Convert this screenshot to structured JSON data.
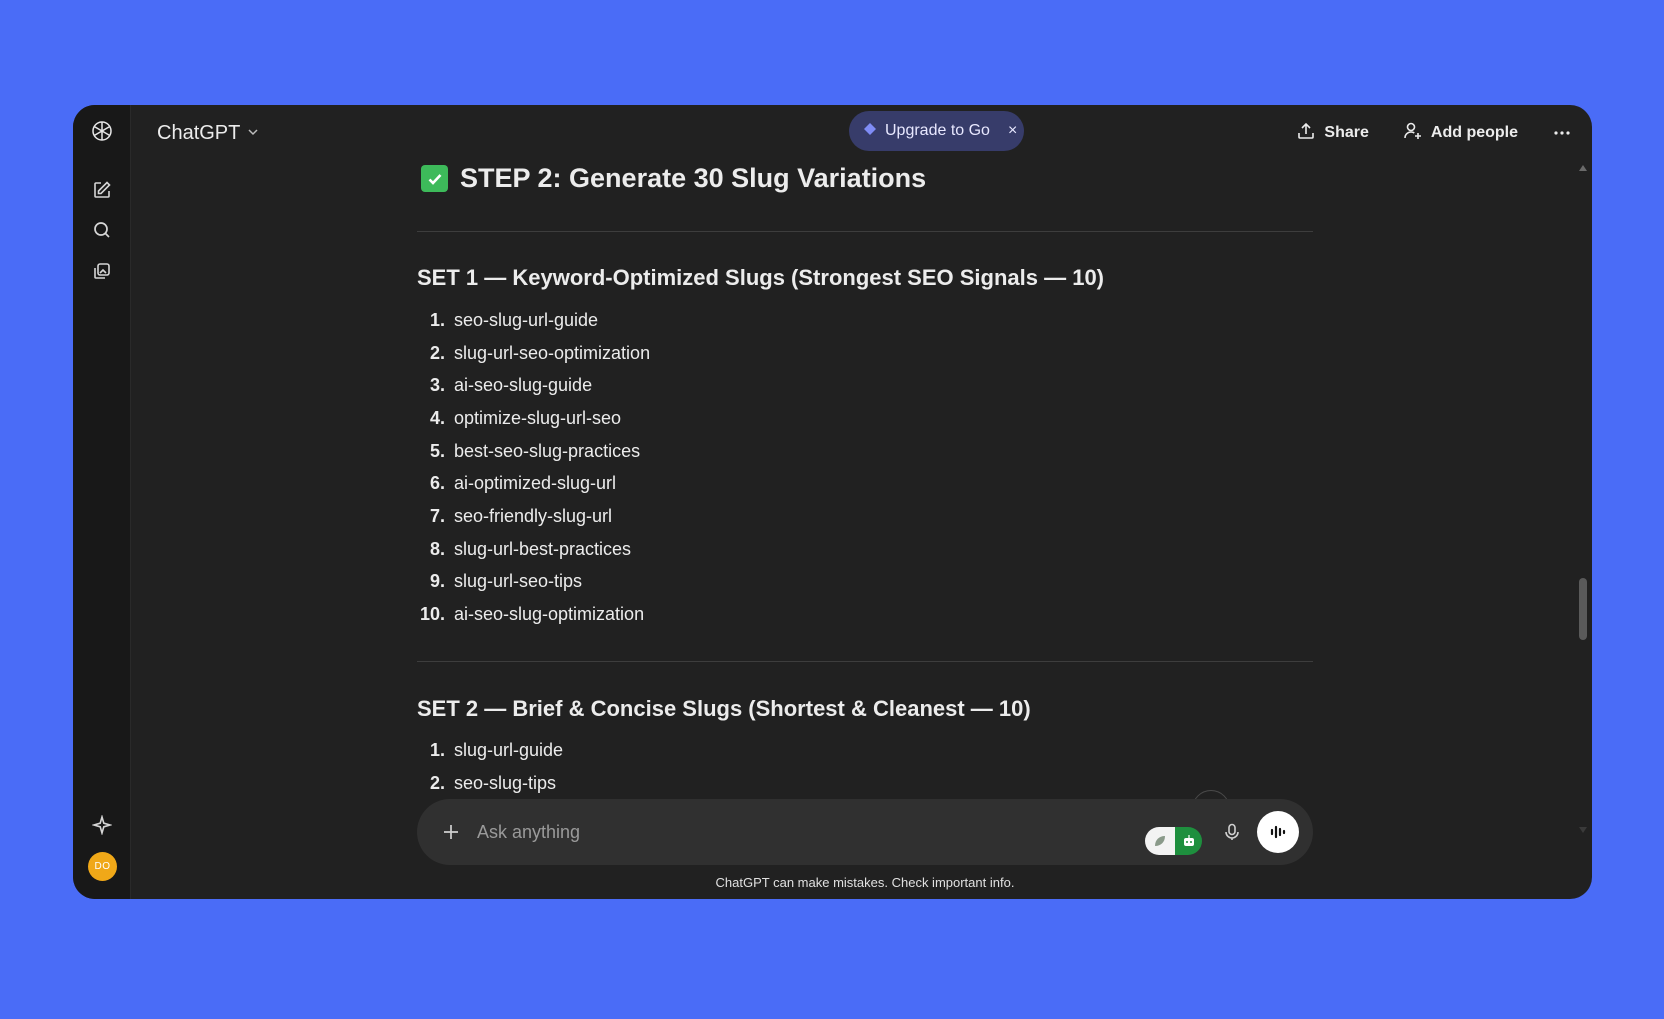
{
  "header": {
    "model_name": "ChatGPT",
    "upgrade_label": "Upgrade to Go",
    "upgrade_close": "×",
    "share_label": "Share",
    "add_people_label": "Add people"
  },
  "sidebar": {
    "avatar_initials": "DO"
  },
  "main": {
    "step_title": "STEP 2: Generate 30 Slug Variations",
    "set1": {
      "title": "SET 1 — Keyword-Optimized Slugs (Strongest SEO Signals — 10)",
      "items": [
        {
          "num": "1.",
          "text": "seo-slug-url-guide"
        },
        {
          "num": "2.",
          "text": "slug-url-seo-optimization"
        },
        {
          "num": "3.",
          "text": "ai-seo-slug-guide"
        },
        {
          "num": "4.",
          "text": "optimize-slug-url-seo"
        },
        {
          "num": "5.",
          "text": "best-seo-slug-practices"
        },
        {
          "num": "6.",
          "text": "ai-optimized-slug-url"
        },
        {
          "num": "7.",
          "text": "seo-friendly-slug-url"
        },
        {
          "num": "8.",
          "text": "slug-url-best-practices"
        },
        {
          "num": "9.",
          "text": "slug-url-seo-tips"
        },
        {
          "num": "10.",
          "text": "ai-seo-slug-optimization"
        }
      ]
    },
    "set2": {
      "title": "SET 2 — Brief & Concise Slugs (Shortest & Cleanest — 10)",
      "items": [
        {
          "num": "1.",
          "text": "slug-url-guide"
        },
        {
          "num": "2.",
          "text": "seo-slug-tips"
        }
      ]
    }
  },
  "composer": {
    "placeholder": "Ask anything"
  },
  "footer": {
    "disclaimer": "ChatGPT can make mistakes. Check important info."
  },
  "colors": {
    "background": "#4a6cf7",
    "window": "#212121",
    "upgrade_pill": "#373c6a",
    "check": "#3dba5a",
    "avatar": "#f0a818"
  }
}
